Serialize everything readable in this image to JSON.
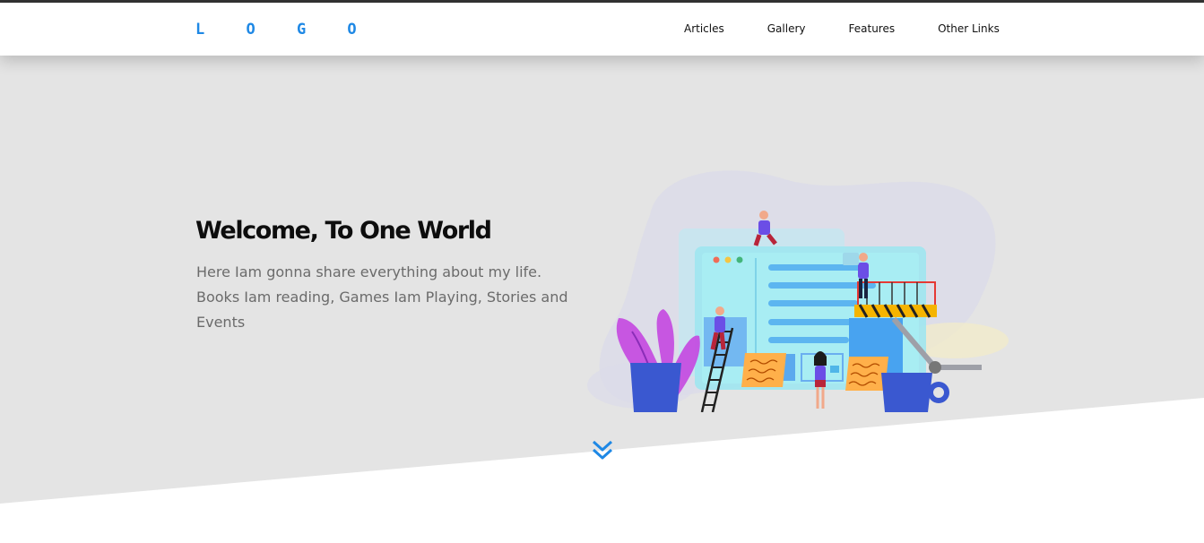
{
  "header": {
    "logo": "L O G O",
    "nav": [
      {
        "label": "Articles"
      },
      {
        "label": "Gallery"
      },
      {
        "label": "Features"
      },
      {
        "label": "Other Links"
      }
    ]
  },
  "hero": {
    "title": "Welcome, To One World",
    "description": "Here Iam gonna share everything about my life. Books Iam reading, Games Iam Playing, Stories and Events",
    "illustration_icon": "web-design-team-illustration",
    "scroll_icon": "chevron-double-down-icon"
  },
  "colors": {
    "accent": "#1e88e5",
    "hero_background": "#e4e4e4",
    "topbar": "#333333"
  }
}
